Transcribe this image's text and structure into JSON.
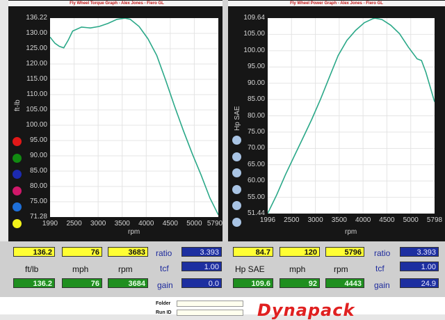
{
  "left": {
    "title": "Fly Wheel Torque Graph - Alex Jones - Fiero GL",
    "y_unit": "ft-lb",
    "x_unit": "rpm",
    "y_ticks": [
      "136.22",
      "130.00",
      "125.00",
      "120.00",
      "115.00",
      "110.00",
      "105.00",
      "100.00",
      "95.00",
      "90.00",
      "85.00",
      "80.00",
      "75.00",
      "71.28"
    ],
    "x_ticks": [
      "1990",
      "2500",
      "3000",
      "3500",
      "4000",
      "4500",
      "5000",
      "5790"
    ],
    "indicator_colors": [
      "#e01818",
      "#118a11",
      "#1c2ab0",
      "#d0186a",
      "#1e6fd8",
      "#f2f21a"
    ],
    "readout": {
      "value1": "136.2",
      "value2": "76",
      "value3": "3683",
      "label1": "ft/lb",
      "label2": "mph",
      "label3": "rpm",
      "green1": "136.2",
      "green2": "76",
      "green3": "3684",
      "ratio_label": "ratio",
      "ratio": "3.393",
      "tcf_label": "tcf",
      "tcf": "1.00",
      "gain_label": "gain",
      "gain": "0.0"
    }
  },
  "right": {
    "title": "Fly Wheel Power Graph - Alex Jones - Fiero GL",
    "y_unit": "Hp SAE",
    "x_unit": "rpm",
    "y_ticks": [
      "109.64",
      "105.00",
      "100.00",
      "95.00",
      "90.00",
      "85.00",
      "80.00",
      "75.00",
      "70.00",
      "65.00",
      "60.00",
      "55.00",
      "51.44"
    ],
    "x_ticks": [
      "1996",
      "2500",
      "3000",
      "3500",
      "4000",
      "4500",
      "5000",
      "5798"
    ],
    "indicator_colors": [
      "#a9c4e4",
      "#a9c4e4",
      "#a9c4e4",
      "#a9c4e4",
      "#a9c4e4",
      "#a9c4e4"
    ],
    "readout": {
      "value1": "84.7",
      "value2": "120",
      "value3": "5796",
      "label1": "Hp SAE",
      "label2": "mph",
      "label3": "rpm",
      "green1": "109.6",
      "green2": "92",
      "green3": "4443",
      "ratio_label": "ratio",
      "ratio": "3.393",
      "tcf_label": "tcf",
      "tcf": "1.00",
      "gain_label": "gain",
      "gain": "24.9"
    }
  },
  "bottom": {
    "folder_label": "Folder",
    "run_label": "Run ID",
    "logo": "Dynapack"
  },
  "chart_data": [
    {
      "type": "line",
      "title": "Fly Wheel Torque Graph - Alex Jones - Fiero GL",
      "xlabel": "rpm",
      "ylabel": "ft-lb",
      "xlim": [
        1990,
        5790
      ],
      "ylim": [
        71.28,
        136.22
      ],
      "grid": true,
      "series": [
        {
          "color": "#2aa888",
          "x": [
            1990,
            2100,
            2200,
            2300,
            2400,
            2500,
            2700,
            2900,
            3100,
            3300,
            3500,
            3683,
            3800,
            4000,
            4200,
            4400,
            4600,
            4800,
            5000,
            5200,
            5400,
            5600,
            5790
          ],
          "y": [
            130.0,
            128.0,
            127.0,
            126.5,
            129.0,
            132.0,
            133.3,
            133.0,
            133.5,
            134.5,
            135.8,
            136.2,
            135.8,
            133.5,
            129.5,
            124.0,
            116.0,
            107.5,
            99.5,
            92.0,
            85.0,
            77.5,
            72.0
          ]
        }
      ]
    },
    {
      "type": "line",
      "title": "Fly Wheel Power Graph - Alex Jones - Fiero GL",
      "xlabel": "rpm",
      "ylabel": "Hp SAE",
      "xlim": [
        1996,
        5798
      ],
      "ylim": [
        51.44,
        109.64
      ],
      "grid": true,
      "series": [
        {
          "color": "#2aa888",
          "x": [
            1996,
            2200,
            2400,
            2600,
            2800,
            3000,
            3200,
            3400,
            3600,
            3800,
            4000,
            4200,
            4400,
            4443,
            4600,
            4800,
            5000,
            5200,
            5400,
            5500,
            5600,
            5798
          ],
          "y": [
            51.5,
            57.0,
            63.0,
            68.5,
            74.0,
            79.5,
            85.5,
            92.0,
            98.5,
            103.0,
            106.0,
            108.3,
            109.5,
            109.6,
            109.2,
            107.5,
            105.0,
            101.0,
            97.5,
            97.0,
            93.5,
            84.7
          ]
        }
      ]
    }
  ]
}
